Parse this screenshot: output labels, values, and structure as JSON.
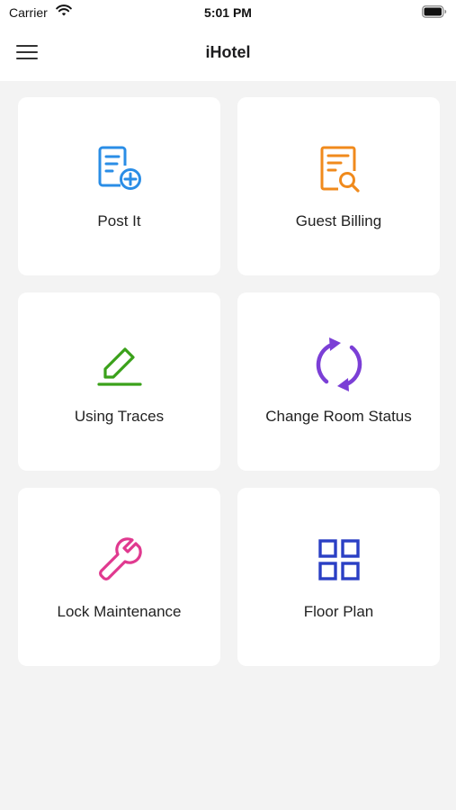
{
  "status_bar": {
    "carrier": "Carrier",
    "time": "5:01 PM"
  },
  "nav": {
    "title": "iHotel",
    "menu_icon": "hamburger-menu-icon"
  },
  "tiles": [
    {
      "label": "Post It",
      "icon": "document-add-icon",
      "color": "#2a8de6"
    },
    {
      "label": "Guest Billing",
      "icon": "document-search-icon",
      "color": "#f08a1c"
    },
    {
      "label": "Using Traces",
      "icon": "edit-pencil-icon",
      "color": "#3aa11a"
    },
    {
      "label": "Change Room Status",
      "icon": "refresh-arrows-icon",
      "color": "#7b3fd6"
    },
    {
      "label": "Lock Maintenance",
      "icon": "wrench-icon",
      "color": "#e0398f"
    },
    {
      "label": "Floor Plan",
      "icon": "grid-icon",
      "color": "#2a3fc4"
    }
  ]
}
